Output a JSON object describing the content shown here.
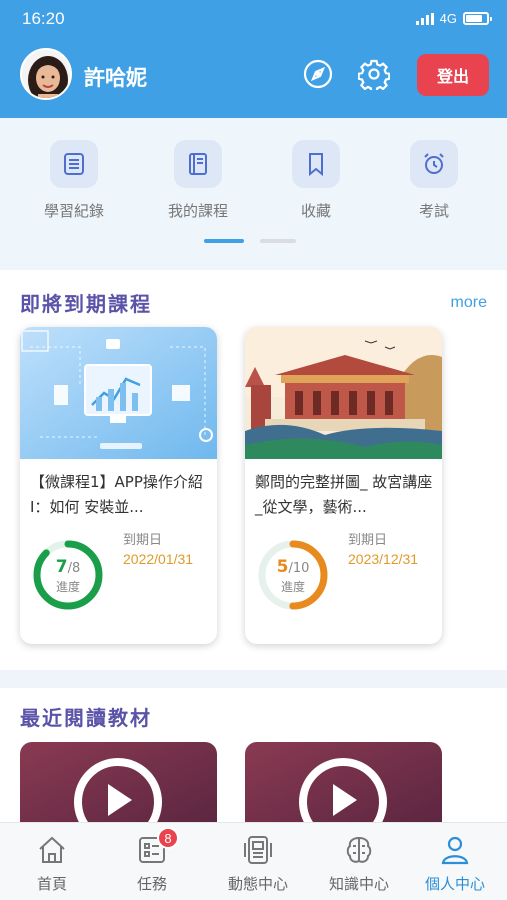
{
  "status_bar": {
    "time": "16:20",
    "network": "4G"
  },
  "header": {
    "username": "許哈妮",
    "logout_label": "登出",
    "icons": [
      "compass-icon",
      "gear-icon"
    ]
  },
  "quick_menu": [
    {
      "label": "學習紀錄",
      "icon": "record-icon"
    },
    {
      "label": "我的課程",
      "icon": "book-icon"
    },
    {
      "label": "收藏",
      "icon": "bookmark-icon"
    },
    {
      "label": "考試",
      "icon": "alarm-clock-icon"
    }
  ],
  "upcoming": {
    "title": "即將到期課程",
    "more_label": "more",
    "courses": [
      {
        "title": "【微課程1】APP操作介紹 I：如何 安裝並...",
        "progress_done": "7",
        "progress_total": "/8",
        "progress_label": "進度",
        "due_label": "到期日",
        "due_date": "2022/01/31",
        "progress": 0.875,
        "ring_color": "#1a9e4a"
      },
      {
        "title": "鄭問的完整拼圖_ 故宮講座 _從文學，藝術...",
        "progress_done": "5",
        "progress_total": "/10",
        "progress_label": "進度",
        "due_label": "到期日",
        "due_date": "2023/12/31",
        "progress": 0.5,
        "ring_color": "#e88a1e"
      }
    ]
  },
  "recent": {
    "title": "最近閱讀教材"
  },
  "tabbar": [
    {
      "label": "首頁",
      "icon": "home-icon"
    },
    {
      "label": "任務",
      "icon": "task-icon",
      "badge": "8"
    },
    {
      "label": "動態中心",
      "icon": "activity-icon"
    },
    {
      "label": "知識中心",
      "icon": "brain-icon"
    },
    {
      "label": "個人中心",
      "icon": "person-icon",
      "active": true
    }
  ],
  "colors": {
    "header": "#3fa0e6",
    "logout": "#e8434f",
    "section_title": "#5b53a8",
    "accent": "#2a8fd6"
  }
}
